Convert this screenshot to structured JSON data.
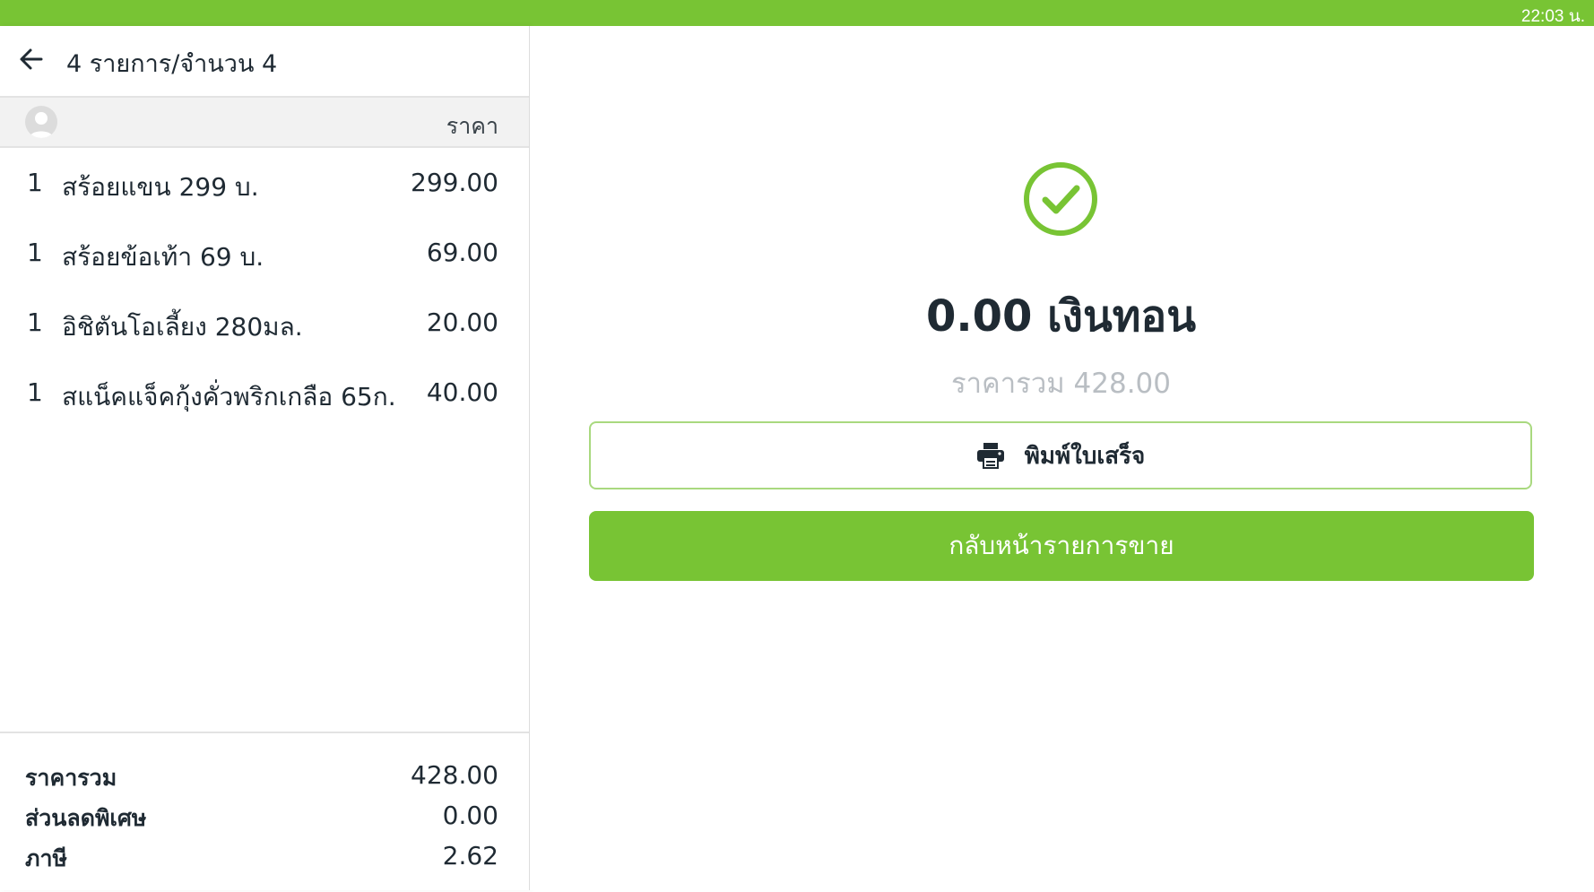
{
  "status_bar": {
    "time": "22:03 น.",
    "color": "#78c434"
  },
  "order": {
    "title": "4 รายการ/จำนวน 4",
    "price_column_label": "ราคา",
    "items": [
      {
        "qty": "1",
        "name": "สร้อยแขน 299 บ.",
        "price": "299.00"
      },
      {
        "qty": "1",
        "name": "สร้อยข้อเท้า 69 บ.",
        "price": "69.00"
      },
      {
        "qty": "1",
        "name": "อิชิตันโอเลี้ยง 280มล.",
        "price": "20.00"
      },
      {
        "qty": "1",
        "name": "สแน็คแจ็คกุ้งคั่วพริกเกลือ 65ก.",
        "price": "40.00"
      }
    ]
  },
  "summary": {
    "subtotal_label": "ราคารวม",
    "subtotal_value": "428.00",
    "discount_label": "ส่วนลดพิเศษ",
    "discount_value": "0.00",
    "tax_label": "ภาษี",
    "tax_value": "2.62"
  },
  "result": {
    "icon": "check-circle-icon",
    "change_text": "0.00 เงินทอน",
    "total_text": "ราคารวม 428.00",
    "print_label": "พิมพ์ใบเสร็จ",
    "back_label": "กลับหน้ารายการขาย",
    "accent_color": "#78c434"
  }
}
